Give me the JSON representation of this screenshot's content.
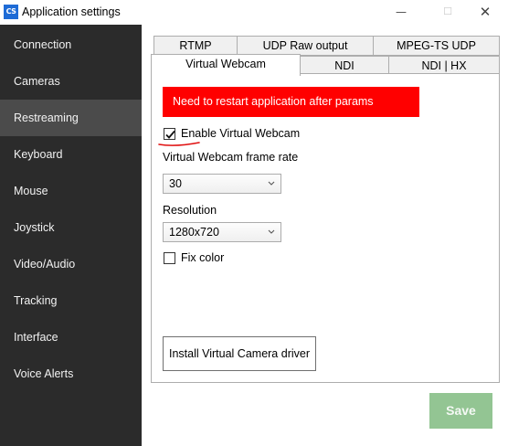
{
  "window": {
    "title": "Application settings",
    "icon_text": "CS",
    "minimize_glyph": "—",
    "maximize_glyph": "☐",
    "close_glyph": "✕"
  },
  "sidebar": {
    "items": [
      {
        "label": "Connection"
      },
      {
        "label": "Cameras"
      },
      {
        "label": "Restreaming",
        "active": true
      },
      {
        "label": "Keyboard"
      },
      {
        "label": "Mouse"
      },
      {
        "label": "Joystick"
      },
      {
        "label": "Video/Audio"
      },
      {
        "label": "Tracking"
      },
      {
        "label": "Interface"
      },
      {
        "label": "Voice Alerts"
      }
    ]
  },
  "tabs": {
    "row1": [
      {
        "label": "RTMP"
      },
      {
        "label": "UDP Raw output"
      },
      {
        "label": "MPEG-TS UDP"
      }
    ],
    "row2": [
      {
        "label": "Virtual Webcam",
        "selected": true
      },
      {
        "label": "NDI"
      },
      {
        "label": "NDI | HX"
      }
    ]
  },
  "virtual_webcam": {
    "warning": "Need to restart application after params changed",
    "enable_label": "Enable Virtual Webcam",
    "enable_checked": true,
    "frame_rate_label": "Virtual Webcam frame rate",
    "frame_rate_value": "30",
    "resolution_label": "Resolution",
    "resolution_value": "1280x720",
    "fix_color_label": "Fix color",
    "fix_color_checked": false,
    "install_button": "Install Virtual Camera driver"
  },
  "footer": {
    "save_label": "Save"
  },
  "colors": {
    "sidebar_bg": "#2b2b2b",
    "sidebar_active": "#4b4b4b",
    "warning_bg": "#ff0000",
    "save_bg": "#93c593",
    "annotation_red": "#e01010"
  }
}
